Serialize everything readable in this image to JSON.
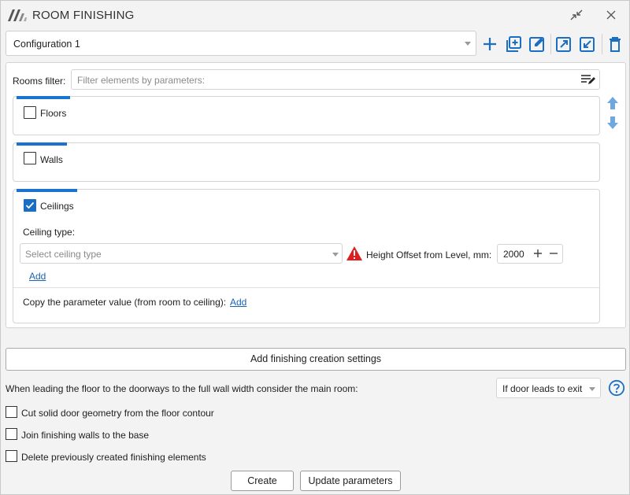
{
  "window": {
    "title": "ROOM FINISHING"
  },
  "config": {
    "selected": "Configuration 1"
  },
  "filter": {
    "label": "Rooms filter:",
    "placeholder": "Filter elements by parameters:"
  },
  "sections": {
    "floors": {
      "label": "Floors",
      "checked": false
    },
    "walls": {
      "label": "Walls",
      "checked": false
    },
    "ceilings": {
      "label": "Ceilings",
      "checked": true,
      "type_label": "Ceiling type:",
      "type_placeholder": "Select ceiling type",
      "offset_label": "Height Offset from Level, mm:",
      "offset_value": "2000",
      "add_label": "Add",
      "copy_label": "Copy the parameter value (from room to ceiling):",
      "copy_add_label": "Add"
    }
  },
  "actions": {
    "add_settings": "Add finishing creation settings",
    "doorway_label": "When leading the floor to the doorways to the full wall width consider the main room:",
    "doorway_value": "If door leads to exit",
    "options": [
      {
        "label": "Cut solid door geometry from the floor contour",
        "checked": false
      },
      {
        "label": "Join finishing walls to the base",
        "checked": false
      },
      {
        "label": "Delete previously created finishing elements",
        "checked": false
      }
    ],
    "create": "Create",
    "update": "Update parameters"
  },
  "colors": {
    "accent": "#1a73d1",
    "warning": "#e02020",
    "link": "#1a62b8",
    "arrow": "#6fa8e0"
  }
}
